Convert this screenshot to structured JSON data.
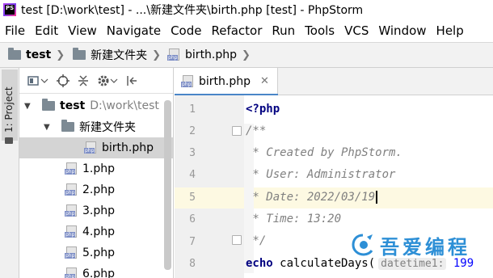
{
  "window": {
    "title": "test [D:\\work\\test] - ...\\新建文件夹\\birth.php [test] - PhpStorm",
    "app_logo_text": "PS"
  },
  "menu": [
    "File",
    "Edit",
    "View",
    "Navigate",
    "Code",
    "Refactor",
    "Run",
    "Tools",
    "VCS",
    "Window",
    "Help"
  ],
  "breadcrumb": [
    "test",
    "新建文件夹",
    "birth.php"
  ],
  "left_stripe": {
    "project_tab": "1: Project"
  },
  "project_tree": {
    "root": {
      "name": "test",
      "path": "D:\\work\\test"
    },
    "folder": "新建文件夹",
    "files": [
      "birth.php",
      "1.php",
      "2.php",
      "3.php",
      "4.php",
      "5.php",
      "6.php"
    ],
    "selected": "birth.php"
  },
  "editor": {
    "tab_label": "birth.php",
    "line_numbers": [
      "1",
      "2",
      "3",
      "4",
      "5",
      "6",
      "7",
      "8"
    ],
    "lines": {
      "l1": "<?php",
      "l2": "/**",
      "l3": " * Created by PhpStorm.",
      "l4": " * User: Administrator",
      "l5": " * Date: 2022/03/19",
      "l6": " * Time: 13:20",
      "l7": " */",
      "l8_keyword": "echo",
      "l8_call": " calculateDays(",
      "l8_hint": "datetime1:",
      "l8_value": "199"
    },
    "caret_line": 5
  },
  "watermark": {
    "text": "吾爱编程"
  },
  "colors": {
    "tab_underline": "#4a86c8",
    "caret_line": "#fdf9e2",
    "keyword": "#000080",
    "comment": "#808080"
  }
}
